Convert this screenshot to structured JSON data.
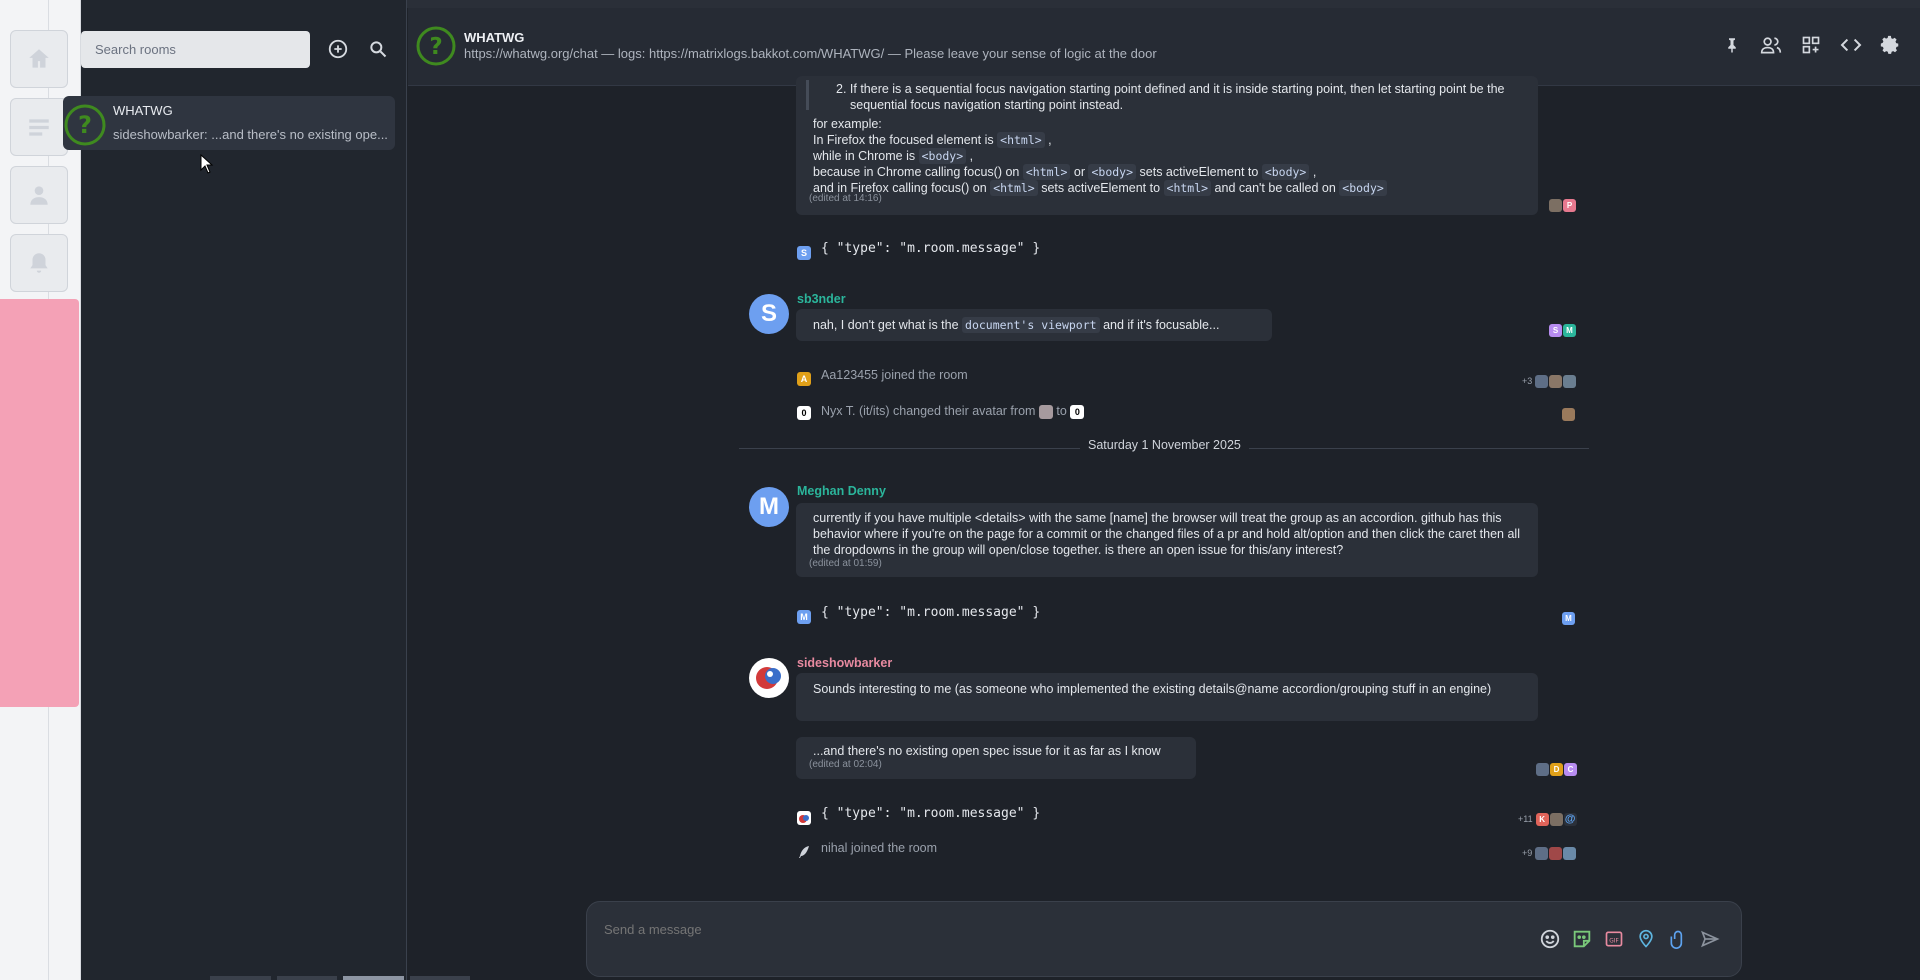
{
  "header": {
    "room_name": "WHATWG",
    "topic": "https://whatwg.org/chat — logs: https://matrixlogs.bakkot.com/WHATWG/ — Please leave your sense of logic at the door"
  },
  "sidebar": {
    "search_placeholder": "Search rooms",
    "room": {
      "name": "WHATWG",
      "preview": "sideshowbarker: ...and there's no existing ope..."
    }
  },
  "messages": {
    "m1": {
      "list_item": "2. If there is a sequential focus navigation starting point defined and it is inside starting point, then let starting point be the sequential focus navigation starting point instead.",
      "for_example": "for example:",
      "l1a": "In Firefox the focused element is",
      "l1b": "<html>",
      "l1c": ",",
      "l2a": "while in Chrome is",
      "l2b": "<body>",
      "l2c": ",",
      "l3a": "because in Chrome calling focus() on",
      "l3b": "<html>",
      "l3c": "or",
      "l3d": "<body>",
      "l3e": "sets activeElement to",
      "l3f": "<body>",
      "l3g": ",",
      "l4a": "and in Firefox calling focus() on",
      "l4b": "<html>",
      "l4c": "sets activeElement to",
      "l4d": "<html>",
      "l4e": "and can't be called on",
      "l4f": "<body>",
      "edited": "(edited at 14:16)"
    },
    "json1": "{ \"type\": \"m.room.message\" }",
    "sb3nder": {
      "sender": "sb3nder",
      "avatar_letter": "S",
      "a": "nah, I don't get what is the",
      "b": "document's viewport",
      "c": "and if it's focusable..."
    },
    "join1": {
      "avatar_letter": "A",
      "text": "Aa123455 joined the room",
      "more": "+3"
    },
    "avatar_change": {
      "avatar_letter": "0",
      "a": "Nyx T. (it/its) changed their avatar from",
      "b": "to",
      "new_letter": "0"
    },
    "date_separator": "Saturday 1 November 2025",
    "meghan": {
      "sender": "Meghan Denny",
      "avatar_letter": "M",
      "text": "currently if you have multiple <details> with the same [name] the browser will treat the group as an accordion. github has this behavior where if you're on the page for a commit or the changed files of a pr and hold alt/option and then click the caret then all the dropdowns in the group will open/close together. is there an open issue for this/any interest?",
      "edited": "(edited at 01:59)"
    },
    "json2": "{ \"type\": \"m.room.message\" }",
    "sideshow": {
      "sender": "sideshowbarker",
      "text1": "Sounds interesting to me (as someone who implemented the existing details@name accordion/grouping stuff in an engine)",
      "text2": "...and there's no existing open spec issue for it as far as I know",
      "edited": "(edited at 02:04)"
    },
    "json3": "{ \"type\": \"m.room.message\" }",
    "more3": "+11",
    "join2": {
      "text": "nihal joined the room",
      "more": "+9"
    }
  },
  "receipts": {
    "r1": [
      "P"
    ],
    "r2": [
      "S",
      "M"
    ],
    "r5": [
      "M"
    ],
    "r6": [
      "D",
      "C"
    ],
    "r7": [
      "K",
      "@"
    ]
  },
  "composer": {
    "placeholder": "Send a message"
  },
  "colors": {
    "accent_teal": "#2bb59b",
    "sender_pink": "#e88aa0",
    "avatar_blue": "#6d9ff0",
    "space_highlight": "#f4a1b6",
    "composer_placeholder": "#c59a33"
  }
}
